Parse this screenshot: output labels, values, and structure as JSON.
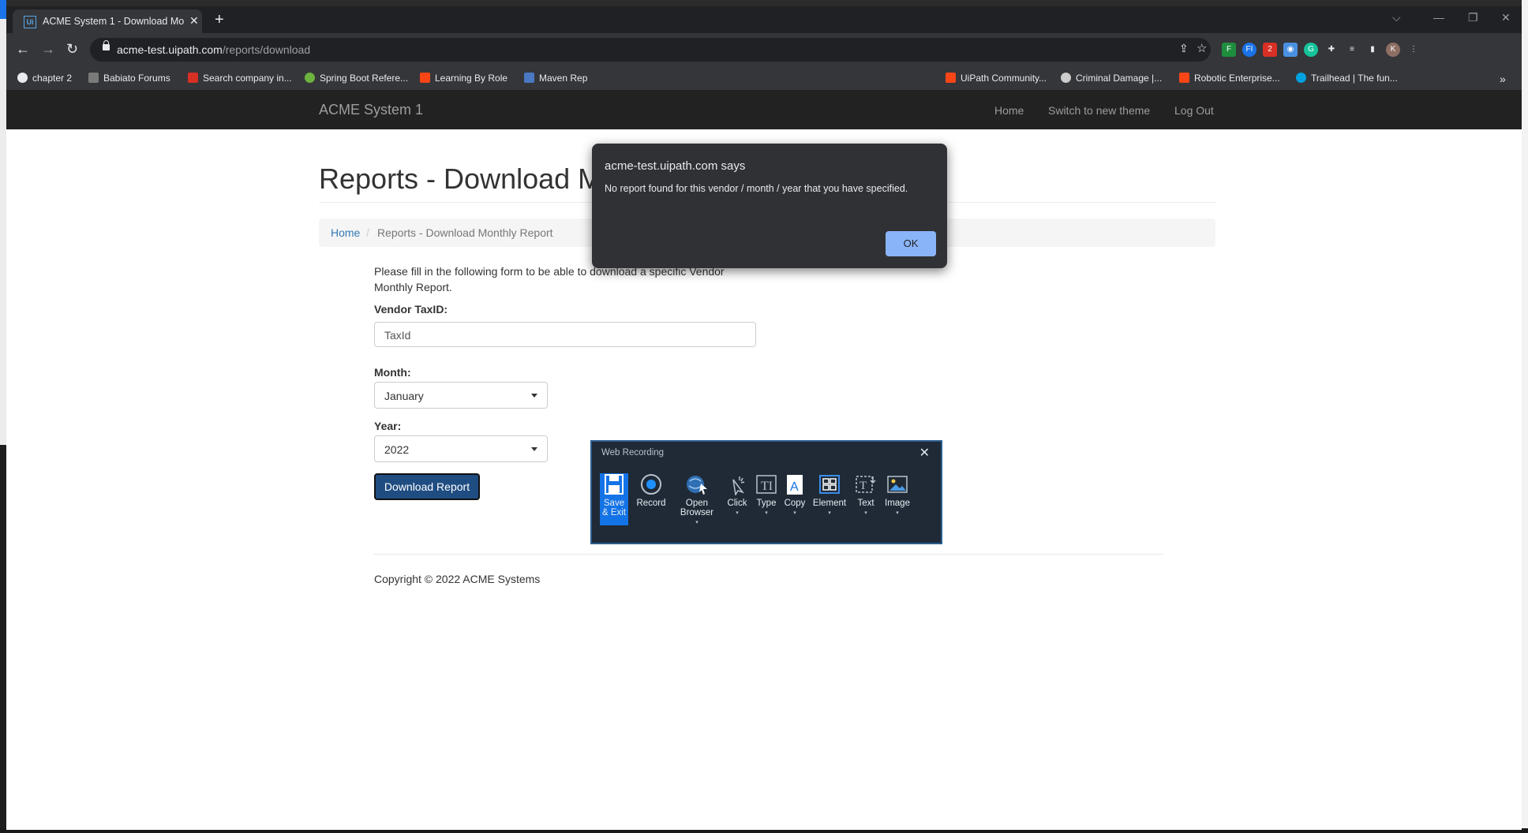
{
  "browser": {
    "tab_title": "ACME System 1 - Download Mon",
    "tab_icon": "uipath-favicon-icon",
    "url_host": "acme-test.uipath.com",
    "url_path": "/reports/download",
    "bookmarks": [
      {
        "label": "chapter 2",
        "color": "#e8eaed"
      },
      {
        "label": "Babiato Forums",
        "color": "#7a7a7a"
      },
      {
        "label": "Search company in...",
        "color": "#d93025"
      },
      {
        "label": "Spring Boot Refere...",
        "color": "#6db33f"
      },
      {
        "label": "Learning By Role",
        "color": "#fa4616"
      },
      {
        "label": "Maven Rep",
        "color": "#4a78c2"
      },
      {
        "label": "UiPath Community...",
        "color": "#fa4616"
      },
      {
        "label": "Criminal Damage |...",
        "color": "#cccccc"
      },
      {
        "label": "Robotic Enterprise...",
        "color": "#fa4616"
      },
      {
        "label": "Trailhead | The fun...",
        "color": "#00a1e0"
      }
    ],
    "avatar_letter": "K"
  },
  "site": {
    "brand": "ACME System 1",
    "nav": {
      "home": "Home",
      "switch_theme": "Switch to new theme",
      "logout": "Log Out"
    },
    "heading": "Reports - Download Monthly Report",
    "breadcrumb": {
      "home": "Home",
      "separator": "/",
      "current": "Reports - Download Monthly Report"
    },
    "intro": "Please fill in the following form to be able to download a specific Vendor Monthly Report.",
    "form": {
      "taxid_label": "Vendor TaxID:",
      "taxid_placeholder": "TaxId",
      "month_label": "Month:",
      "month_value": "January",
      "year_label": "Year:",
      "year_value": "2022",
      "submit": "Download Report"
    },
    "footer": "Copyright © 2022 ACME Systems"
  },
  "alert": {
    "title": "acme-test.uipath.com says",
    "message": "No report found for this vendor / month / year that you have specified.",
    "ok": "OK"
  },
  "web_recording": {
    "title": "Web Recording",
    "tools": [
      {
        "label1": "Save",
        "label2": "& Exit",
        "icon": "save-icon"
      },
      {
        "label1": "Record",
        "label2": "",
        "icon": "record-icon"
      },
      {
        "label1": "Open",
        "label2": "Browser",
        "icon": "globe-cursor-icon"
      },
      {
        "label1": "Click",
        "label2": "",
        "icon": "click-icon"
      },
      {
        "label1": "Type",
        "label2": "",
        "icon": "type-icon"
      },
      {
        "label1": "Copy",
        "label2": "",
        "icon": "copy-icon"
      },
      {
        "label1": "Element",
        "label2": "",
        "icon": "element-icon"
      },
      {
        "label1": "Text",
        "label2": "",
        "icon": "text-icon"
      },
      {
        "label1": "Image",
        "label2": "",
        "icon": "image-icon"
      }
    ]
  }
}
